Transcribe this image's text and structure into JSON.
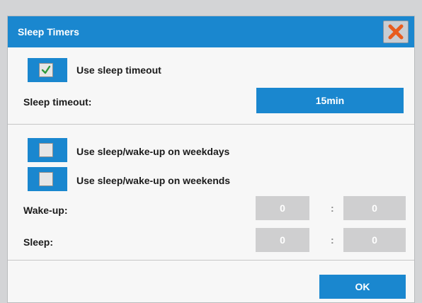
{
  "dialog": {
    "title": "Sleep Timers",
    "close_icon": "close-x-icon"
  },
  "sleep_timeout_section": {
    "use_sleep_timeout_label": "Use sleep timeout",
    "use_sleep_timeout_checked": true,
    "sleep_timeout_label": "Sleep timeout:",
    "sleep_timeout_value": "15min"
  },
  "schedule_section": {
    "weekdays_label": "Use sleep/wake-up on weekdays",
    "weekdays_checked": false,
    "weekends_label": "Use sleep/wake-up on weekends",
    "weekends_checked": false,
    "wakeup_label": "Wake-up:",
    "wakeup_hour": "0",
    "wakeup_minute": "0",
    "sleep_label": "Sleep:",
    "sleep_hour": "0",
    "sleep_minute": "0",
    "separator": ":"
  },
  "footer": {
    "ok_label": "OK"
  },
  "colors": {
    "accent": "#1a87cf",
    "disabled_field": "#cfcfd0",
    "close_x": "#e85c1e"
  }
}
